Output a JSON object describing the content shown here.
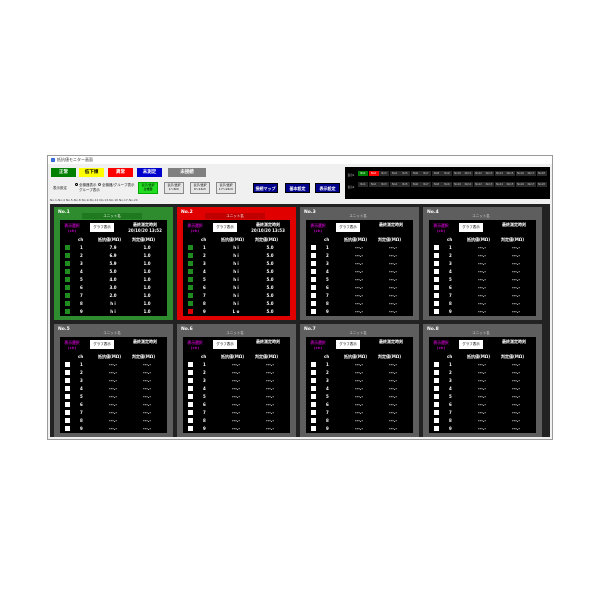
{
  "window": {
    "title": "抵抗値モニター画面"
  },
  "status_buttons": [
    {
      "label": "正常",
      "bg": "#008000",
      "fg": "#ffffff"
    },
    {
      "label": "低下傾",
      "bg": "#ffff00",
      "fg": "#000000"
    },
    {
      "label": "異常",
      "bg": "#ff0000",
      "fg": "#ffffff"
    },
    {
      "label": "未測定",
      "bg": "#0000cd",
      "fg": "#ffffff"
    },
    {
      "label": "未接続",
      "bg": "#808080",
      "fg": "#ffffff"
    }
  ],
  "display_settings": {
    "label": "表示設定",
    "option1": "全機器表示",
    "option1b": "グループ表示",
    "option2": "全機器/グループ表示"
  },
  "filter_buttons": [
    {
      "line1": "表示/選択",
      "line2": "全機器",
      "active": true
    },
    {
      "line1": "表示/選択",
      "line2": "1～8ch",
      "active": false
    },
    {
      "line1": "表示/選択",
      "line2": "9～16ch",
      "active": false
    },
    {
      "line1": "表示/選択",
      "line2": "17～24ch",
      "active": false
    }
  ],
  "nav_buttons": [
    "接続マップ",
    "基本設定",
    "表示設定"
  ],
  "status_grid": {
    "row_labels": [
      "表示1",
      "表示2"
    ],
    "cells": [
      "No1",
      "No2",
      "No3",
      "No4",
      "No5",
      "No6",
      "No7",
      "No8",
      "No9",
      "No10",
      "No11",
      "No12",
      "No13",
      "No14",
      "No15",
      "No16",
      "No17",
      "No18"
    ],
    "active_cells": [
      {
        "row": 0,
        "index": 0,
        "color": "#008000"
      },
      {
        "row": 0,
        "index": 1,
        "color": "#ff0000"
      }
    ]
  },
  "tabs": "No.1-No.4  No.5-No.8  No.9-No.12  No.13-No.16  No.17-No.20",
  "panel_labels": {
    "unit_name": "ユニット名",
    "display_label_line1": "表示選択",
    "display_label_line2": "(ch)",
    "graph_button": "グラフ表示",
    "last_measure_label": "最終測定時刻",
    "ch_header": "ch",
    "resistance_header": "抵抗値(MΩ)",
    "judgment_header": "判定値(MΩ)"
  },
  "panels": [
    {
      "no": "No.1",
      "border": "#2e8b2e",
      "unit_bg": "#1f7a1f",
      "unit_fg": "#ffffff",
      "timestamp": "20/10/20 13:52",
      "rows": [
        {
          "ch": "1",
          "val": "7.9",
          "judge": "1.0",
          "status": "#1e8c1e"
        },
        {
          "ch": "2",
          "val": "6.9",
          "judge": "1.0",
          "status": "#1e8c1e"
        },
        {
          "ch": "3",
          "val": "5.9",
          "judge": "1.0",
          "status": "#1e8c1e"
        },
        {
          "ch": "4",
          "val": "5.0",
          "judge": "1.0",
          "status": "#1e8c1e"
        },
        {
          "ch": "5",
          "val": "4.0",
          "judge": "1.0",
          "status": "#1e8c1e"
        },
        {
          "ch": "6",
          "val": "3.0",
          "judge": "1.0",
          "status": "#1e8c1e"
        },
        {
          "ch": "7",
          "val": "2.0",
          "judge": "1.0",
          "status": "#1e8c1e"
        },
        {
          "ch": "8",
          "val": "h i",
          "judge": "1.0",
          "status": "#1e8c1e"
        },
        {
          "ch": "9",
          "val": "h i",
          "judge": "1.0",
          "status": "#1e8c1e"
        }
      ]
    },
    {
      "no": "No.2",
      "border": "#e00000",
      "unit_bg": "#c00000",
      "unit_fg": "#ffffff",
      "timestamp": "20/10/20 13:53",
      "rows": [
        {
          "ch": "1",
          "val": "h i",
          "judge": "5.0",
          "status": "#1e8c1e"
        },
        {
          "ch": "2",
          "val": "h i",
          "judge": "5.0",
          "status": "#1e8c1e"
        },
        {
          "ch": "3",
          "val": "h i",
          "judge": "5.0",
          "status": "#1e8c1e"
        },
        {
          "ch": "4",
          "val": "h i",
          "judge": "5.0",
          "status": "#1e8c1e"
        },
        {
          "ch": "5",
          "val": "h i",
          "judge": "5.0",
          "status": "#1e8c1e"
        },
        {
          "ch": "6",
          "val": "h i",
          "judge": "5.0",
          "status": "#1e8c1e"
        },
        {
          "ch": "7",
          "val": "h i",
          "judge": "5.0",
          "status": "#1e8c1e"
        },
        {
          "ch": "8",
          "val": "h i",
          "judge": "5.0",
          "status": "#1e8c1e"
        },
        {
          "ch": "9",
          "val": "L o",
          "judge": "5.0",
          "status": "#e00000"
        }
      ]
    },
    {
      "no": "No.3",
      "border": "#5e5e5e",
      "unit_bg": "#5e5e5e",
      "unit_fg": "#dddddd",
      "timestamp": "",
      "rows": [
        {
          "ch": "1",
          "val": "---.-",
          "judge": "---.-",
          "status": "#ffffff"
        },
        {
          "ch": "2",
          "val": "---.-",
          "judge": "---.-",
          "status": "#ffffff"
        },
        {
          "ch": "3",
          "val": "---.-",
          "judge": "---.-",
          "status": "#ffffff"
        },
        {
          "ch": "4",
          "val": "---.-",
          "judge": "---.-",
          "status": "#ffffff"
        },
        {
          "ch": "5",
          "val": "---.-",
          "judge": "---.-",
          "status": "#ffffff"
        },
        {
          "ch": "6",
          "val": "---.-",
          "judge": "---.-",
          "status": "#ffffff"
        },
        {
          "ch": "7",
          "val": "---.-",
          "judge": "---.-",
          "status": "#ffffff"
        },
        {
          "ch": "8",
          "val": "---.-",
          "judge": "---.-",
          "status": "#ffffff"
        },
        {
          "ch": "9",
          "val": "---.-",
          "judge": "---.-",
          "status": "#ffffff"
        }
      ]
    },
    {
      "no": "No.4",
      "border": "#5e5e5e",
      "unit_bg": "#5e5e5e",
      "unit_fg": "#dddddd",
      "timestamp": "",
      "rows": [
        {
          "ch": "1",
          "val": "---.-",
          "judge": "---.-",
          "status": "#ffffff"
        },
        {
          "ch": "2",
          "val": "---.-",
          "judge": "---.-",
          "status": "#ffffff"
        },
        {
          "ch": "3",
          "val": "---.-",
          "judge": "---.-",
          "status": "#ffffff"
        },
        {
          "ch": "4",
          "val": "---.-",
          "judge": "---.-",
          "status": "#ffffff"
        },
        {
          "ch": "5",
          "val": "---.-",
          "judge": "---.-",
          "status": "#ffffff"
        },
        {
          "ch": "6",
          "val": "---.-",
          "judge": "---.-",
          "status": "#ffffff"
        },
        {
          "ch": "7",
          "val": "---.-",
          "judge": "---.-",
          "status": "#ffffff"
        },
        {
          "ch": "8",
          "val": "---.-",
          "judge": "---.-",
          "status": "#ffffff"
        },
        {
          "ch": "9",
          "val": "---.-",
          "judge": "---.-",
          "status": "#ffffff"
        }
      ]
    },
    {
      "no": "No.5",
      "border": "#5e5e5e",
      "unit_bg": "#5e5e5e",
      "unit_fg": "#dddddd",
      "timestamp": "",
      "rows": [
        {
          "ch": "1",
          "val": "---.-",
          "judge": "---.-",
          "status": "#ffffff"
        },
        {
          "ch": "2",
          "val": "---.-",
          "judge": "---.-",
          "status": "#ffffff"
        },
        {
          "ch": "3",
          "val": "---.-",
          "judge": "---.-",
          "status": "#ffffff"
        },
        {
          "ch": "4",
          "val": "---.-",
          "judge": "---.-",
          "status": "#ffffff"
        },
        {
          "ch": "5",
          "val": "---.-",
          "judge": "---.-",
          "status": "#ffffff"
        },
        {
          "ch": "6",
          "val": "---.-",
          "judge": "---.-",
          "status": "#ffffff"
        },
        {
          "ch": "7",
          "val": "---.-",
          "judge": "---.-",
          "status": "#ffffff"
        },
        {
          "ch": "8",
          "val": "---.-",
          "judge": "---.-",
          "status": "#ffffff"
        },
        {
          "ch": "9",
          "val": "---.-",
          "judge": "---.-",
          "status": "#ffffff"
        }
      ]
    },
    {
      "no": "No.6",
      "border": "#5e5e5e",
      "unit_bg": "#5e5e5e",
      "unit_fg": "#dddddd",
      "timestamp": "",
      "rows": [
        {
          "ch": "1",
          "val": "---.-",
          "judge": "---.-",
          "status": "#ffffff"
        },
        {
          "ch": "2",
          "val": "---.-",
          "judge": "---.-",
          "status": "#ffffff"
        },
        {
          "ch": "3",
          "val": "---.-",
          "judge": "---.-",
          "status": "#ffffff"
        },
        {
          "ch": "4",
          "val": "---.-",
          "judge": "---.-",
          "status": "#ffffff"
        },
        {
          "ch": "5",
          "val": "---.-",
          "judge": "---.-",
          "status": "#ffffff"
        },
        {
          "ch": "6",
          "val": "---.-",
          "judge": "---.-",
          "status": "#ffffff"
        },
        {
          "ch": "7",
          "val": "---.-",
          "judge": "---.-",
          "status": "#ffffff"
        },
        {
          "ch": "8",
          "val": "---.-",
          "judge": "---.-",
          "status": "#ffffff"
        },
        {
          "ch": "9",
          "val": "---.-",
          "judge": "---.-",
          "status": "#ffffff"
        }
      ]
    },
    {
      "no": "No.7",
      "border": "#5e5e5e",
      "unit_bg": "#5e5e5e",
      "unit_fg": "#dddddd",
      "timestamp": "",
      "rows": [
        {
          "ch": "1",
          "val": "---.-",
          "judge": "---.-",
          "status": "#ffffff"
        },
        {
          "ch": "2",
          "val": "---.-",
          "judge": "---.-",
          "status": "#ffffff"
        },
        {
          "ch": "3",
          "val": "---.-",
          "judge": "---.-",
          "status": "#ffffff"
        },
        {
          "ch": "4",
          "val": "---.-",
          "judge": "---.-",
          "status": "#ffffff"
        },
        {
          "ch": "5",
          "val": "---.-",
          "judge": "---.-",
          "status": "#ffffff"
        },
        {
          "ch": "6",
          "val": "---.-",
          "judge": "---.-",
          "status": "#ffffff"
        },
        {
          "ch": "7",
          "val": "---.-",
          "judge": "---.-",
          "status": "#ffffff"
        },
        {
          "ch": "8",
          "val": "---.-",
          "judge": "---.-",
          "status": "#ffffff"
        },
        {
          "ch": "9",
          "val": "---.-",
          "judge": "---.-",
          "status": "#ffffff"
        }
      ]
    },
    {
      "no": "No.8",
      "border": "#5e5e5e",
      "unit_bg": "#5e5e5e",
      "unit_fg": "#dddddd",
      "timestamp": "",
      "rows": [
        {
          "ch": "1",
          "val": "---.-",
          "judge": "---.-",
          "status": "#ffffff"
        },
        {
          "ch": "2",
          "val": "---.-",
          "judge": "---.-",
          "status": "#ffffff"
        },
        {
          "ch": "3",
          "val": "---.-",
          "judge": "---.-",
          "status": "#ffffff"
        },
        {
          "ch": "4",
          "val": "---.-",
          "judge": "---.-",
          "status": "#ffffff"
        },
        {
          "ch": "5",
          "val": "---.-",
          "judge": "---.-",
          "status": "#ffffff"
        },
        {
          "ch": "6",
          "val": "---.-",
          "judge": "---.-",
          "status": "#ffffff"
        },
        {
          "ch": "7",
          "val": "---.-",
          "judge": "---.-",
          "status": "#ffffff"
        },
        {
          "ch": "8",
          "val": "---.-",
          "judge": "---.-",
          "status": "#ffffff"
        },
        {
          "ch": "9",
          "val": "---.-",
          "judge": "---.-",
          "status": "#ffffff"
        }
      ]
    }
  ]
}
